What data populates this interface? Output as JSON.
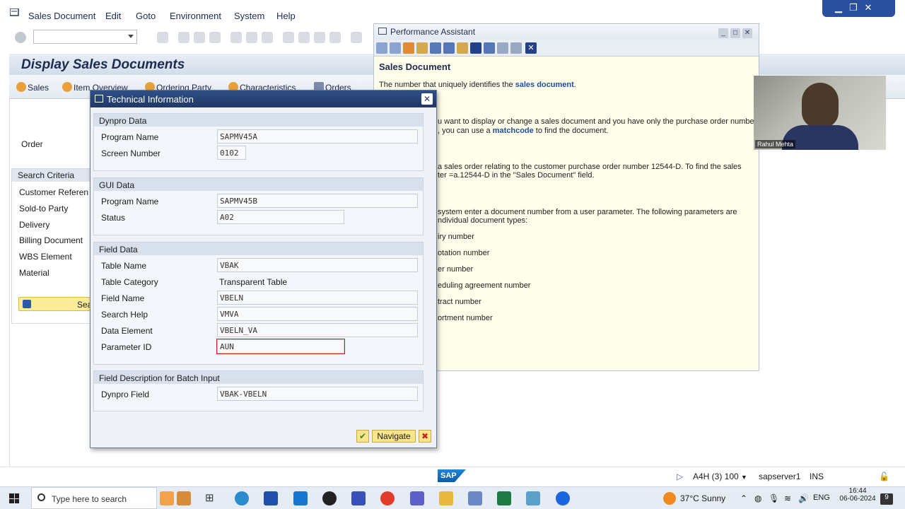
{
  "menubar": {
    "items": [
      "Sales Document",
      "Edit",
      "Goto",
      "Environment",
      "System",
      "Help"
    ]
  },
  "screen": {
    "title": "Display Sales Documents",
    "app_toolbar": [
      "Sales",
      "Item Overview",
      "Ordering Party",
      "Characteristics",
      "Orders"
    ],
    "order_label": "Order",
    "search_criteria_header": "Search Criteria",
    "search_criteria_items": [
      "Customer Referen",
      "Sold-to Party",
      "Delivery",
      "Billing Document",
      "WBS Element",
      "Material"
    ],
    "search_button": "Sea"
  },
  "perf_assistant": {
    "title": "Performance Assistant",
    "heading": "Sales Document",
    "intro_prefix": "The number that uniquely identifies the ",
    "intro_link": "sales document",
    "intro_suffix": ".",
    "line1": "u want to display or change a sales document and you have only the purchase order number",
    "line2_prefix": ", you can use a ",
    "line2_link": "matchcode",
    "line2_suffix": " to find the document.",
    "line3": "a sales order relating to the customer purchase order number 12544-D. To find the sales",
    "line4": "ter =a.12544-D in the \"Sales Document\" field.",
    "line5": "system enter a document number from a user parameter. The following parameters are",
    "line6": "ndividual document types:",
    "list": [
      "iry number",
      "otation number",
      "er number",
      "eduling agreement number",
      "tract number",
      "ortment number"
    ]
  },
  "webcam": {
    "name": "Rahul Mehta"
  },
  "tech_info": {
    "title": "Technical Information",
    "dynpro": {
      "header": "Dynpro Data",
      "program_name_label": "Program Name",
      "program_name": "SAPMV45A",
      "screen_number_label": "Screen Number",
      "screen_number": "0102"
    },
    "gui": {
      "header": "GUI Data",
      "program_name_label": "Program Name",
      "program_name": "SAPMV45B",
      "status_label": "Status",
      "status": "A02"
    },
    "field": {
      "header": "Field Data",
      "table_name_label": "Table Name",
      "table_name": "VBAK",
      "table_category_label": "Table Category",
      "table_category": "Transparent Table",
      "field_name_label": "Field Name",
      "field_name": "VBELN",
      "search_help_label": "Search Help",
      "search_help": "VMVA",
      "data_element_label": "Data Element",
      "data_element": "VBELN_VA",
      "parameter_id_label": "Parameter ID",
      "parameter_id": "AUN"
    },
    "batch": {
      "header": "Field Description for Batch Input",
      "dynpro_field_label": "Dynpro Field",
      "dynpro_field": "VBAK-VBELN"
    },
    "navigate_label": "Navigate"
  },
  "statusbar": {
    "system": "A4H (3) 100",
    "server": "sapserver1",
    "mode": "INS"
  },
  "taskbar": {
    "search_placeholder": "Type here to search",
    "weather": "37°C  Sunny",
    "lang": "ENG",
    "time": "16:44",
    "date": "06-06-2024",
    "notif_count": "9"
  },
  "colors": {
    "dialog_title": "#1f3866",
    "perf_bg": "#fffeeb",
    "accent_button": "#fbe58b"
  }
}
